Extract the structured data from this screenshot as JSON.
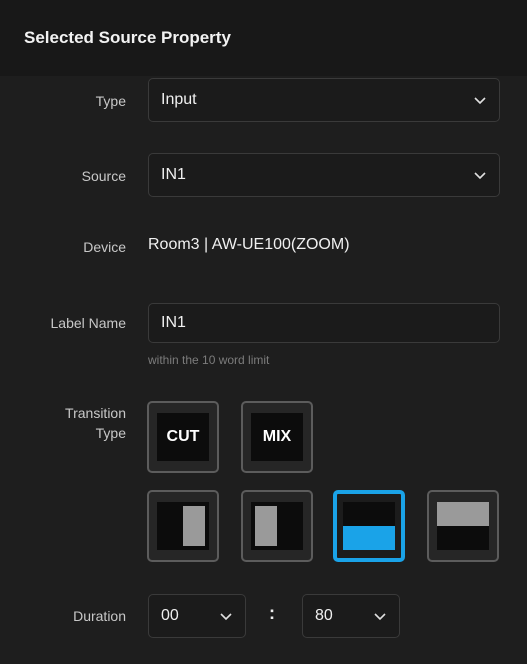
{
  "panel": {
    "title": "Selected Source Property"
  },
  "type_field": {
    "label": "Type",
    "value": "Input"
  },
  "source_field": {
    "label": "Source",
    "value": "IN1"
  },
  "device_field": {
    "label": "Device",
    "value": "Room3 | AW-UE100(ZOOM)"
  },
  "label_name_field": {
    "label": "Label Name",
    "value": "IN1",
    "hint": "within the 10 word limit"
  },
  "transition": {
    "label_line1": "Transition",
    "label_line2": "Type",
    "buttons": [
      {
        "label": "CUT"
      },
      {
        "label": "MIX"
      }
    ],
    "wipes": [
      {
        "name": "wipe-right-half",
        "selected": false
      },
      {
        "name": "wipe-left-half",
        "selected": false
      },
      {
        "name": "wipe-bottom-half",
        "selected": true
      },
      {
        "name": "wipe-top-half",
        "selected": false
      }
    ]
  },
  "duration": {
    "label": "Duration",
    "seconds": "00",
    "separator": ":",
    "frames": "80"
  },
  "colors": {
    "accent": "#1aa3e8",
    "background": "#1e1e1e",
    "header": "#181818",
    "wipe_gray": "#9a9a9a"
  }
}
